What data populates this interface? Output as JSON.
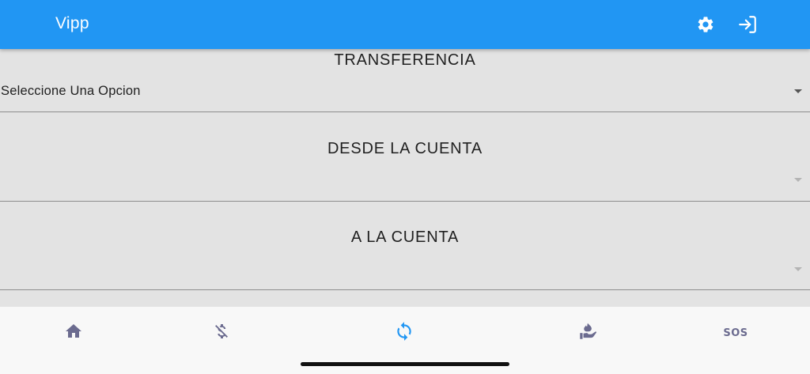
{
  "appbar": {
    "title": "Vipp",
    "actions": [
      {
        "icon": "gear-icon",
        "label": "settings"
      },
      {
        "icon": "login-icon",
        "label": "login"
      }
    ],
    "color": "#2196f3"
  },
  "form": {
    "transfer_type": {
      "title": "TRANSFERENCIA",
      "selected": "Seleccione Una Opcion"
    },
    "from_account": {
      "title": "DESDE LA CUENTA"
    },
    "to_account": {
      "title": "A LA CUENTA"
    }
  },
  "bottom_nav": {
    "items": [
      {
        "icon": "home-icon",
        "active": false
      },
      {
        "icon": "money-off-icon",
        "active": false
      },
      {
        "icon": "sync-icon",
        "active": true
      },
      {
        "icon": "donate-hand-icon",
        "active": false
      },
      {
        "icon": "sos-icon",
        "label": "SOS",
        "active": false
      }
    ],
    "active_color": "#2196f3",
    "inactive_color": "#6b6b8f"
  }
}
